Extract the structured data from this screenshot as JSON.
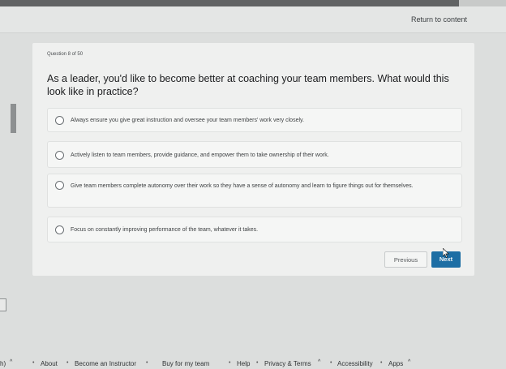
{
  "header": {
    "return_label": "Return to content"
  },
  "question": {
    "counter": "Question 8 of 50",
    "text": "As a leader, you'd like to become better at coaching your team members. What would this look like in practice?"
  },
  "options": [
    {
      "label": "Always ensure you give great instruction and oversee your team members' work very closely."
    },
    {
      "label": "Actively listen to team members, provide guidance, and empower them to take ownership of their work."
    },
    {
      "label": "Give team members complete autonomy over their work so they have a sense of autonomy and learn to figure things out for themselves."
    },
    {
      "label": "Focus on constantly improving performance of the team, whatever it takes."
    }
  ],
  "buttons": {
    "previous": "Previous",
    "next": "Next"
  },
  "footer": {
    "left_fragment": "h)",
    "about": "About",
    "instructor": "Become an Instructor",
    "buy": "Buy for my team",
    "help": "Help",
    "privacy": "Privacy & Terms",
    "accessibility": "Accessibility",
    "apps": "Apps"
  },
  "icons": {
    "chevron": "chevron-up-icon",
    "radio": "radio-empty-icon",
    "cursor": "mouse-cursor-icon"
  }
}
